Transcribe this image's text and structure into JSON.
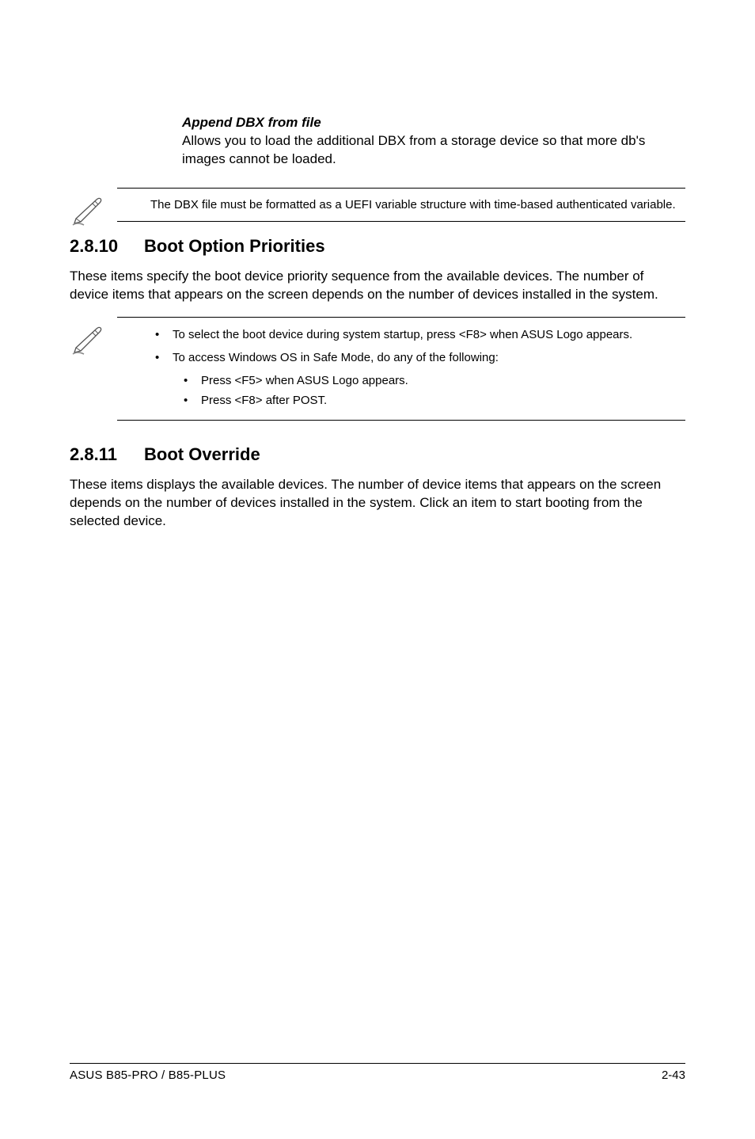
{
  "topSection": {
    "subheading": "Append DBX from file",
    "text": "Allows you to load the additional DBX from a storage device so that more db's images cannot be loaded."
  },
  "note1": {
    "text": "The DBX file must be formatted as a UEFI variable structure with time-based authenticated variable."
  },
  "section10": {
    "number": "2.8.10",
    "title": "Boot Option Priorities",
    "body": "These items specify the boot device priority sequence from the available devices. The number of device items that appears on the screen depends on the number of devices installed in the system."
  },
  "note2": {
    "b1a": "To select the boot device during system startup, press <F8> when ASUS Logo appears.",
    "b1b": "To access Windows OS in Safe Mode, do any of the following:",
    "b2a": "Press <F5> when ASUS Logo appears.",
    "b2b": "Press <F8> after POST."
  },
  "section11": {
    "number": "2.8.11",
    "title": "Boot Override",
    "body": "These items displays the available devices. The number of device items that appears on the screen depends on the number of devices installed in the system. Click an item to start booting from the selected device."
  },
  "footer": {
    "left": "ASUS B85-PRO / B85-PLUS",
    "right": "2-43"
  }
}
